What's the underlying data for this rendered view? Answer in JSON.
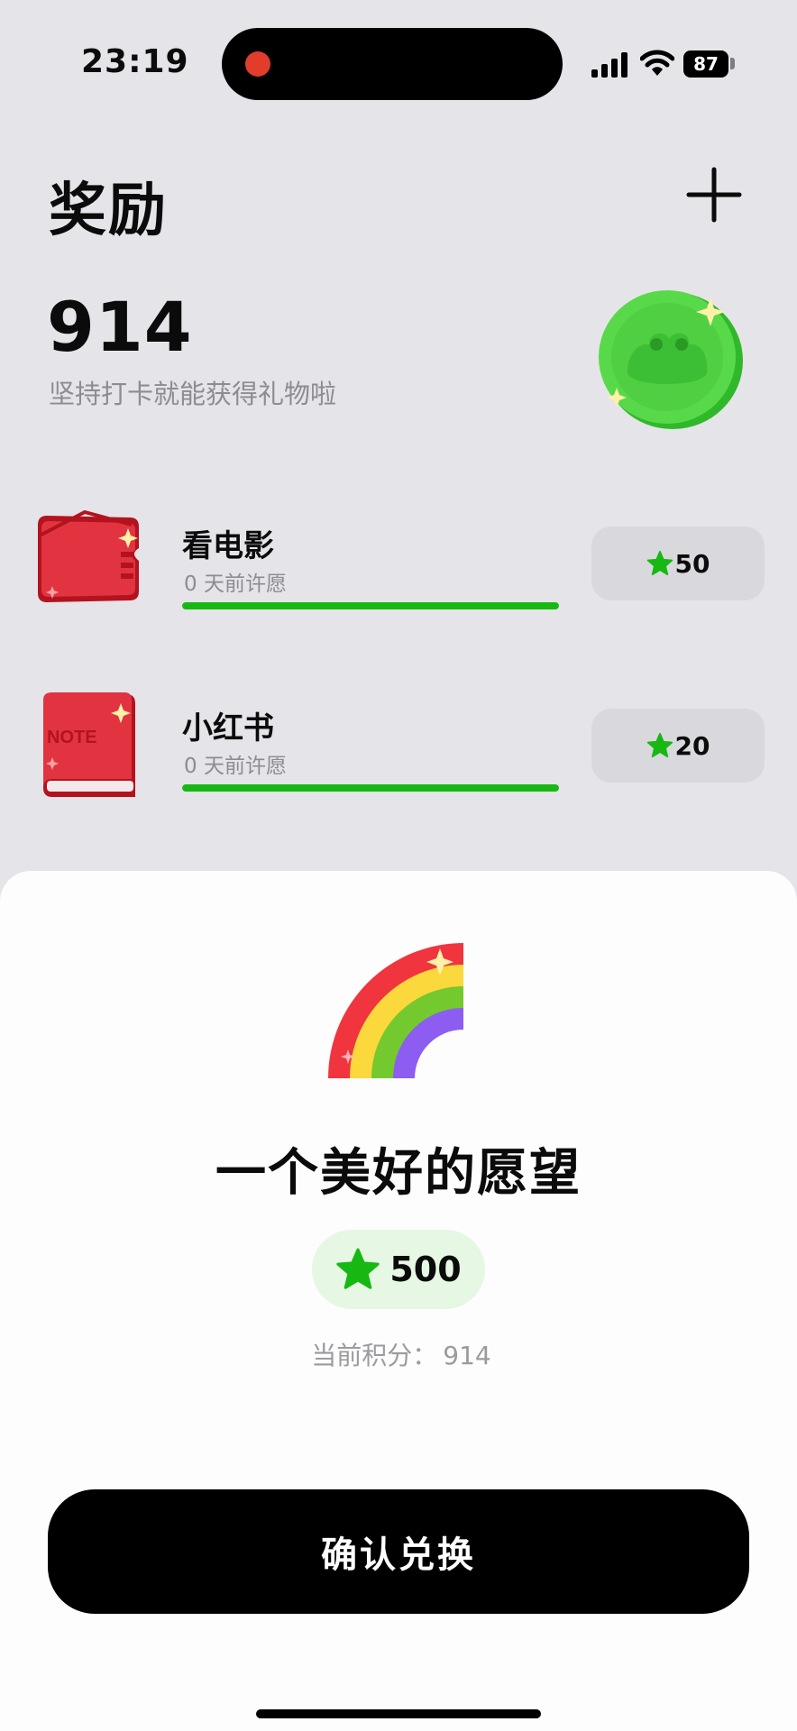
{
  "status_bar": {
    "time": "23:19",
    "battery": "87",
    "icons": [
      "recording-dot-icon",
      "signal-icon",
      "wifi-icon",
      "battery-icon"
    ]
  },
  "header": {
    "title": "奖励",
    "add_icon": "plus-icon"
  },
  "balance": {
    "points": "914",
    "caption": "坚持打卡就能获得礼物啦",
    "icon": "frog-coin-icon"
  },
  "rewards": [
    {
      "name": "看电影",
      "subtitle": "0 天前许愿",
      "cost": "50",
      "icon": "movie-ticket-icon",
      "progress": 1.0
    },
    {
      "name": "小红书",
      "subtitle": "0 天前许愿",
      "cost": "20",
      "icon": "note-book-icon",
      "icon_text": "NOTE",
      "progress": 1.0
    }
  ],
  "sheet": {
    "icon": "rainbow-icon",
    "title": "一个美好的愿望",
    "cost": "500",
    "current_points_label": "当前积分：",
    "current_points_value": "914",
    "confirm_label": "确认兑换"
  },
  "colors": {
    "background": "#e5e4e8",
    "accent_green": "#17b812",
    "sheet": "#fdfdfd",
    "button": "#000000",
    "badge_green": "#e6f7e4"
  }
}
